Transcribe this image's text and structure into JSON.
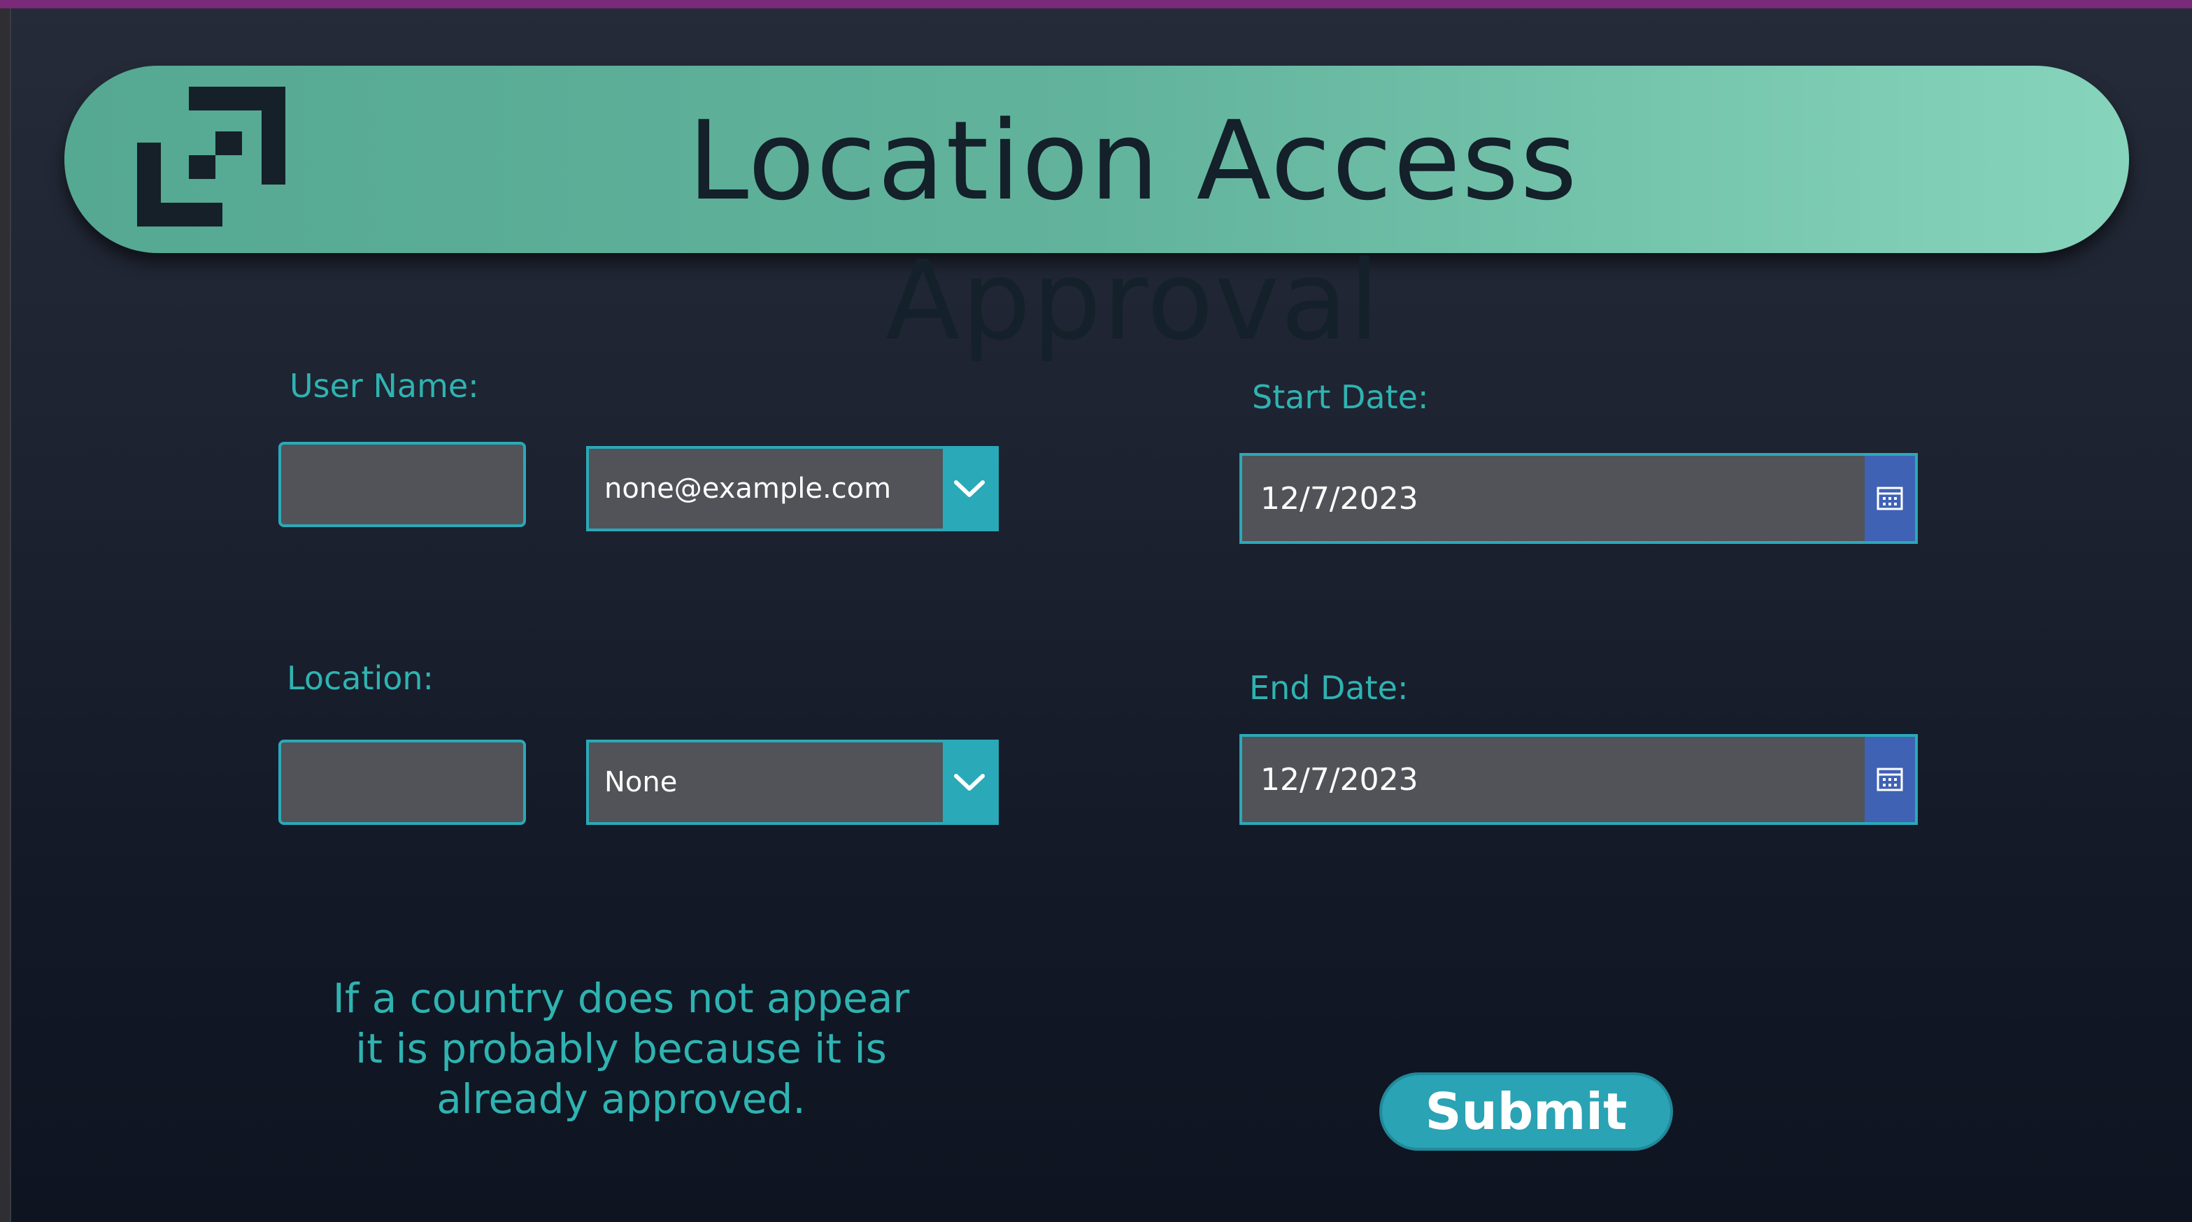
{
  "header": {
    "title": "Location Access Approval",
    "logo_icon": "brand-logo-icon"
  },
  "form": {
    "user_name": {
      "label": "User Name:",
      "text_value": "",
      "dropdown_value": "none@example.com",
      "dropdown_icon": "chevron-down-icon"
    },
    "location": {
      "label": "Location:",
      "text_value": "",
      "dropdown_value": "None",
      "dropdown_icon": "chevron-down-icon"
    },
    "start_date": {
      "label": "Start Date:",
      "value": "12/7/2023",
      "icon": "calendar-icon"
    },
    "end_date": {
      "label": "End Date:",
      "value": "12/7/2023",
      "icon": "calendar-icon"
    },
    "info_text": "If a country does not appear it is probably because it is already approved.",
    "submit_label": "Submit"
  },
  "colors": {
    "accent": "#2aa9b8",
    "label_text": "#2fb3b1",
    "banner": "#62b39c",
    "calendar_button": "#3f62b5",
    "field_bg": "#525358",
    "top_strip": "#7a2a78"
  }
}
